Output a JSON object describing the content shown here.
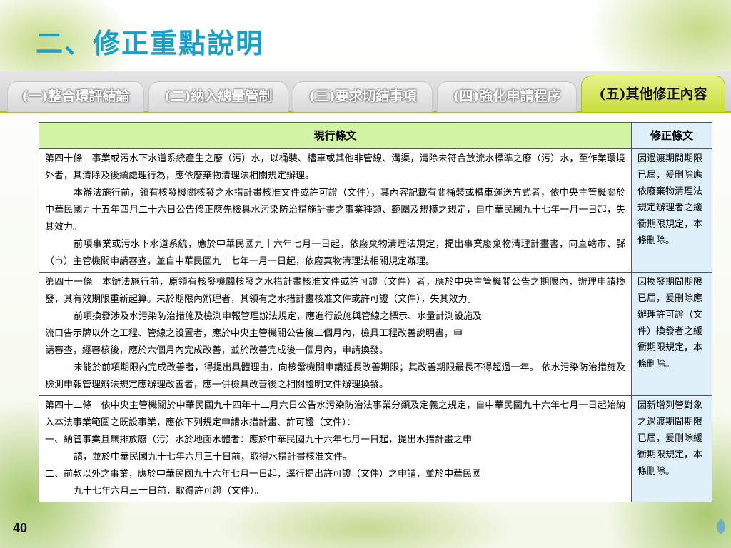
{
  "title": "二、修正重點說明",
  "tabs": [
    {
      "label": "(一)整合環評結論",
      "active": false
    },
    {
      "label": "(二)納入總量管制",
      "active": false
    },
    {
      "label": "(三)要求切結事項",
      "active": false
    },
    {
      "label": "(四)強化申請程序",
      "active": false
    },
    {
      "label": "(五)其他修正內容",
      "active": true
    }
  ],
  "table": {
    "header_current": "現行條文",
    "header_revised": "修正條文",
    "rows": [
      {
        "current": [
          "第四十條　事業或污水下水道系統產生之廢（污）水，以桶裝、槽車或其他非管線、溝渠，清除未符合放流水標準之廢（污）水，至作業環境外者，其清除及後續處理行為，應依廢棄物清理法相關規定辦理。",
          "本辦法施行前，領有核發機關核發之水措計畫核准文件或許可證（文件），其內容記載有關桶裝或槽車運送方式者，依中央主管機關於中華民國九十五年四月二十六日公告修正應先檢具水污染防治措施計畫之事業種類、範圍及規模之規定，自中華民國九十七年一月一日起，失其效力。",
          "前項事業或污水下水道系統，應於中華民國九十六年七月一日起，依廢棄物清理法規定，提出事業廢棄物清理計畫書，向直轄市、縣（市）主管機關申請審查，並自中華民國九十七年一月一日起，依廢棄物清理法相關規定辦理。"
        ],
        "revised": "因過渡期間期限已屆，爰刪除應依廢棄物清理法規定辦理者之緩衝期限規定，本條刪除。"
      },
      {
        "current": [
          "第四十一條　本辦法施行前，原領有核發機關核發之水措計畫核准文件或許可證（文件）者，應於中央主管機關公告之期限內，辦理申請換發，其有效期限重新起算。未於期限內辦理者，其領有之水措計畫核准文件或許可證（文件），失其效力。",
          "前項換發涉及水污染防治措施及檢測申報管理辦法規定，應進行設施與管線之標示、水量計測設施及",
          "流口告示牌以外之工程、管線之設置者，應於中央主管機關公告後二個月內，檢具工程改善說明書，申",
          "請審查，經審核後，應於六個月內完成改善，並於改善完成後一個月內，申請換發。",
          "未能於前項期限內完成改善者，得提出具體理由，向核發機關申請延長改善期限；其改善期限最長不得超過一年。 依水污染防治措施及檢測申報管理辦法規定應辦理改善者，應一併檢具改善後之相關證明文件辦理換發。"
        ],
        "revised": "因換發期間期限已屆，爰刪除應辦理許可證（文件）換發者之緩衝期限規定，本條刪除。"
      },
      {
        "current": [
          "第四十二條　依中央主管機關於中華民國九十四年十二月六日公告水污染防治法事業分類及定義之規定，自中華民國九十六年七月一日起始納入本法事業範圍之既設事業，應依下列規定申請水措計畫、許可證（文件）：",
          "一、納管事業且無排放廢（污）水於地面水體者：應於中華民國九十六年七月一日起，提出水措計畫之申",
          "請，並於中華民國九十七年六月三十日前，取得水措計畫核准文件。",
          "二、前款以外之事業，應於中華民國九十六年七月一日起，逕行提出許可證（文件）之申請，並於中華民國",
          "九十七年六月三十日前，取得許可證（文件）。"
        ],
        "revised": "因新增列管對象之過渡期間期限已屆，爰刪除緩衝期限規定，本條刪除。"
      }
    ]
  },
  "page_number": "40",
  "icons": {
    "logo": "leaf-logo-icon"
  }
}
